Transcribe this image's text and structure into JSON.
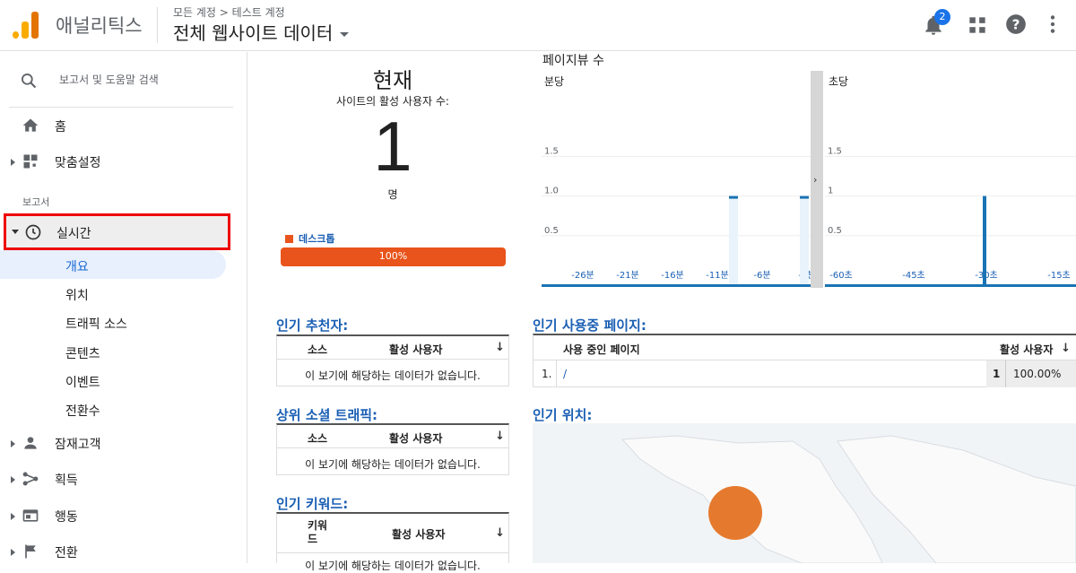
{
  "header": {
    "app_name": "애널리틱스",
    "breadcrumb": "모든 계정 > 테스트 계정",
    "property": "전체 웹사이트 데이터",
    "notification_count": "2"
  },
  "sidebar": {
    "search_placeholder": "보고서 및 도움말 검색",
    "home": "홈",
    "customization": "맞춤설정",
    "reports_section": "보고서",
    "realtime": "실시간",
    "realtime_sub": [
      "개요",
      "위치",
      "트래픽 소스",
      "콘텐츠",
      "이벤트",
      "전환수"
    ],
    "audience": "잠재고객",
    "acquisition": "획득",
    "behavior": "행동",
    "conversions": "전환"
  },
  "now": {
    "title": "현재",
    "subtitle": "사이트의 활성 사용자 수:",
    "count": "1",
    "unit": "명",
    "device_label": "데스크톱",
    "device_percent": "100%"
  },
  "pageviews": {
    "title": "페이지뷰 수",
    "per_minute_label": "분당",
    "per_second_label": "초당"
  },
  "chart_data": [
    {
      "type": "bar",
      "title": "분당",
      "categories": [
        "-26분",
        "-21분",
        "-16분",
        "-11분",
        "-6분",
        "-1분"
      ],
      "y_ticks": [
        "1.5",
        "1.0",
        "0.5"
      ],
      "ylim": [
        0,
        2
      ],
      "values": [
        0,
        0,
        0,
        1,
        0,
        1
      ]
    },
    {
      "type": "bar",
      "title": "초당",
      "categories": [
        "-60초",
        "-45초",
        "-30초",
        "-15초"
      ],
      "y_ticks": [
        "1.5",
        "1",
        "0.5"
      ],
      "ylim": [
        0,
        2
      ],
      "values": [
        0,
        0,
        1,
        0
      ]
    }
  ],
  "top_referrals": {
    "title": "인기 추천자:",
    "col_source": "소스",
    "col_active": "활성 사용자",
    "empty": "이 보기에 해당하는 데이터가 없습니다."
  },
  "top_social": {
    "title": "상위 소셜 트래픽:",
    "col_source": "소스",
    "col_active": "활성 사용자",
    "empty": "이 보기에 해당하는 데이터가 없습니다."
  },
  "top_keywords": {
    "title": "인기 키워드:",
    "col_keyword": "키워드",
    "col_active": "활성 사용자",
    "empty": "이 보기에 해당하는 데이터가 없습니다."
  },
  "top_pages": {
    "title": "인기 사용중 페이지:",
    "col_page": "사용 중인 페이지",
    "col_active": "활성 사용자",
    "rows": [
      {
        "index": "1.",
        "page": "/",
        "count": "1",
        "percent": "100.00%"
      }
    ]
  },
  "top_locations": {
    "title": "인기 위치:"
  },
  "colors": {
    "accent": "#1a5fb4",
    "desktop": "#e8541b",
    "map_marker": "#e57a2e"
  }
}
